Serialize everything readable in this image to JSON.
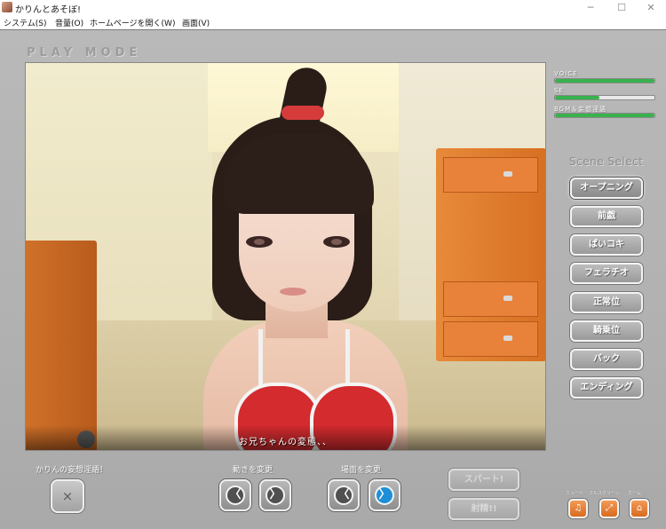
{
  "window": {
    "title": "かりんとあそぼ!",
    "minimize": "─",
    "maximize": "☐",
    "close": "✕"
  },
  "menu": [
    "システム(S)",
    "音量(O)",
    "ホームページを開く(W)",
    "画面(V)"
  ],
  "mode_title": "PLAY MODE",
  "subtitle": "お兄ちゃんの変態、、",
  "sliders": [
    {
      "label": "VOICE",
      "level": 1.0
    },
    {
      "label": "SE",
      "level": 0.45
    },
    {
      "label": "BGM＆妄想淫語",
      "level": 1.0
    }
  ],
  "scene_select": {
    "title": "Scene Select",
    "items": [
      "オープニング",
      "前戯",
      "ぱいコキ",
      "フェラチオ",
      "正常位",
      "騎乗位",
      "バック",
      "エンディング"
    ],
    "active_index": 0
  },
  "bottom": {
    "fantasy_label": "かりんの妄想淫語！",
    "fantasy_button": "×",
    "motion_label": "動きを変更",
    "scene_label": "場面を変更",
    "prev_symbol": "〈",
    "next_symbol": "〉",
    "spurt_button": "スパート!",
    "finish_button": "射精!!",
    "mute_label": "ミュート",
    "fullscreen_label": "フルスクリーン",
    "home_label": "ホーム",
    "mute_icon": "♫",
    "fullscreen_icon": "⤢",
    "home_icon": "⌂"
  },
  "colors": {
    "slider_fill": "#37b24d",
    "next_button": "#1e8fd6",
    "mini_button": "#e27b2d"
  }
}
